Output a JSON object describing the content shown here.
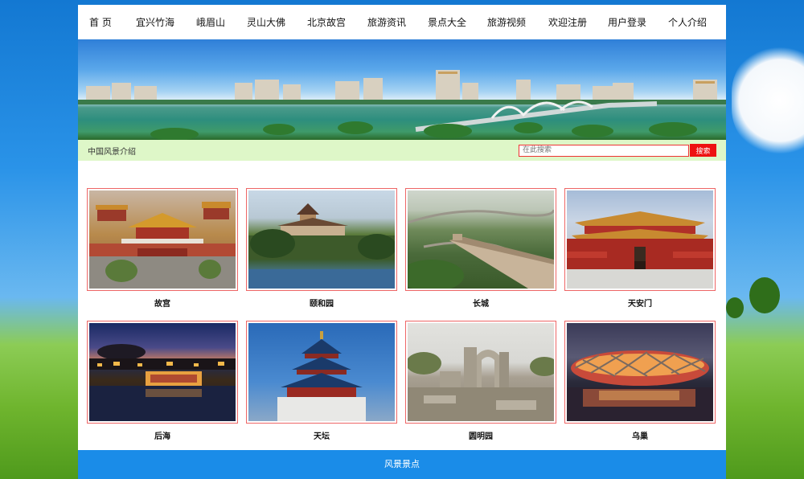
{
  "nav": {
    "items": [
      "首 页",
      "宜兴竹海",
      "峨眉山",
      "灵山大佛",
      "北京故宫",
      "旅游资讯",
      "景点大全",
      "旅游视频",
      "欢迎注册",
      "用户登录",
      "个人介绍"
    ]
  },
  "subbar": {
    "intro": "中国风景介绍",
    "search_placeholder": "在此搜索",
    "search_button": "搜索"
  },
  "gallery": [
    {
      "caption": "故宫",
      "image": "forbidden-city"
    },
    {
      "caption": "颐和园",
      "image": "summer-palace"
    },
    {
      "caption": "长城",
      "image": "great-wall"
    },
    {
      "caption": "天安门",
      "image": "tiananmen"
    },
    {
      "caption": "后海",
      "image": "houhai"
    },
    {
      "caption": "天坛",
      "image": "temple-of-heaven"
    },
    {
      "caption": "圆明园",
      "image": "yuanmingyuan"
    },
    {
      "caption": "乌巢",
      "image": "birds-nest"
    }
  ],
  "footer": {
    "text": "风景景点"
  }
}
